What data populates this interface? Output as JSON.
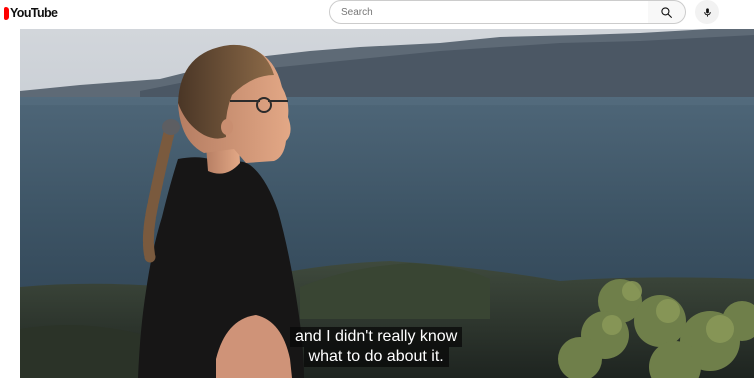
{
  "header": {
    "logo_text": "YouTube",
    "search_placeholder": "Search",
    "search_icon": "search-icon",
    "mic_icon": "microphone-icon"
  },
  "player": {
    "captions": [
      "and I didn't really know",
      "what to do about it."
    ]
  },
  "colors": {
    "brand_red": "#ff0000",
    "caption_bg": "#080808"
  }
}
